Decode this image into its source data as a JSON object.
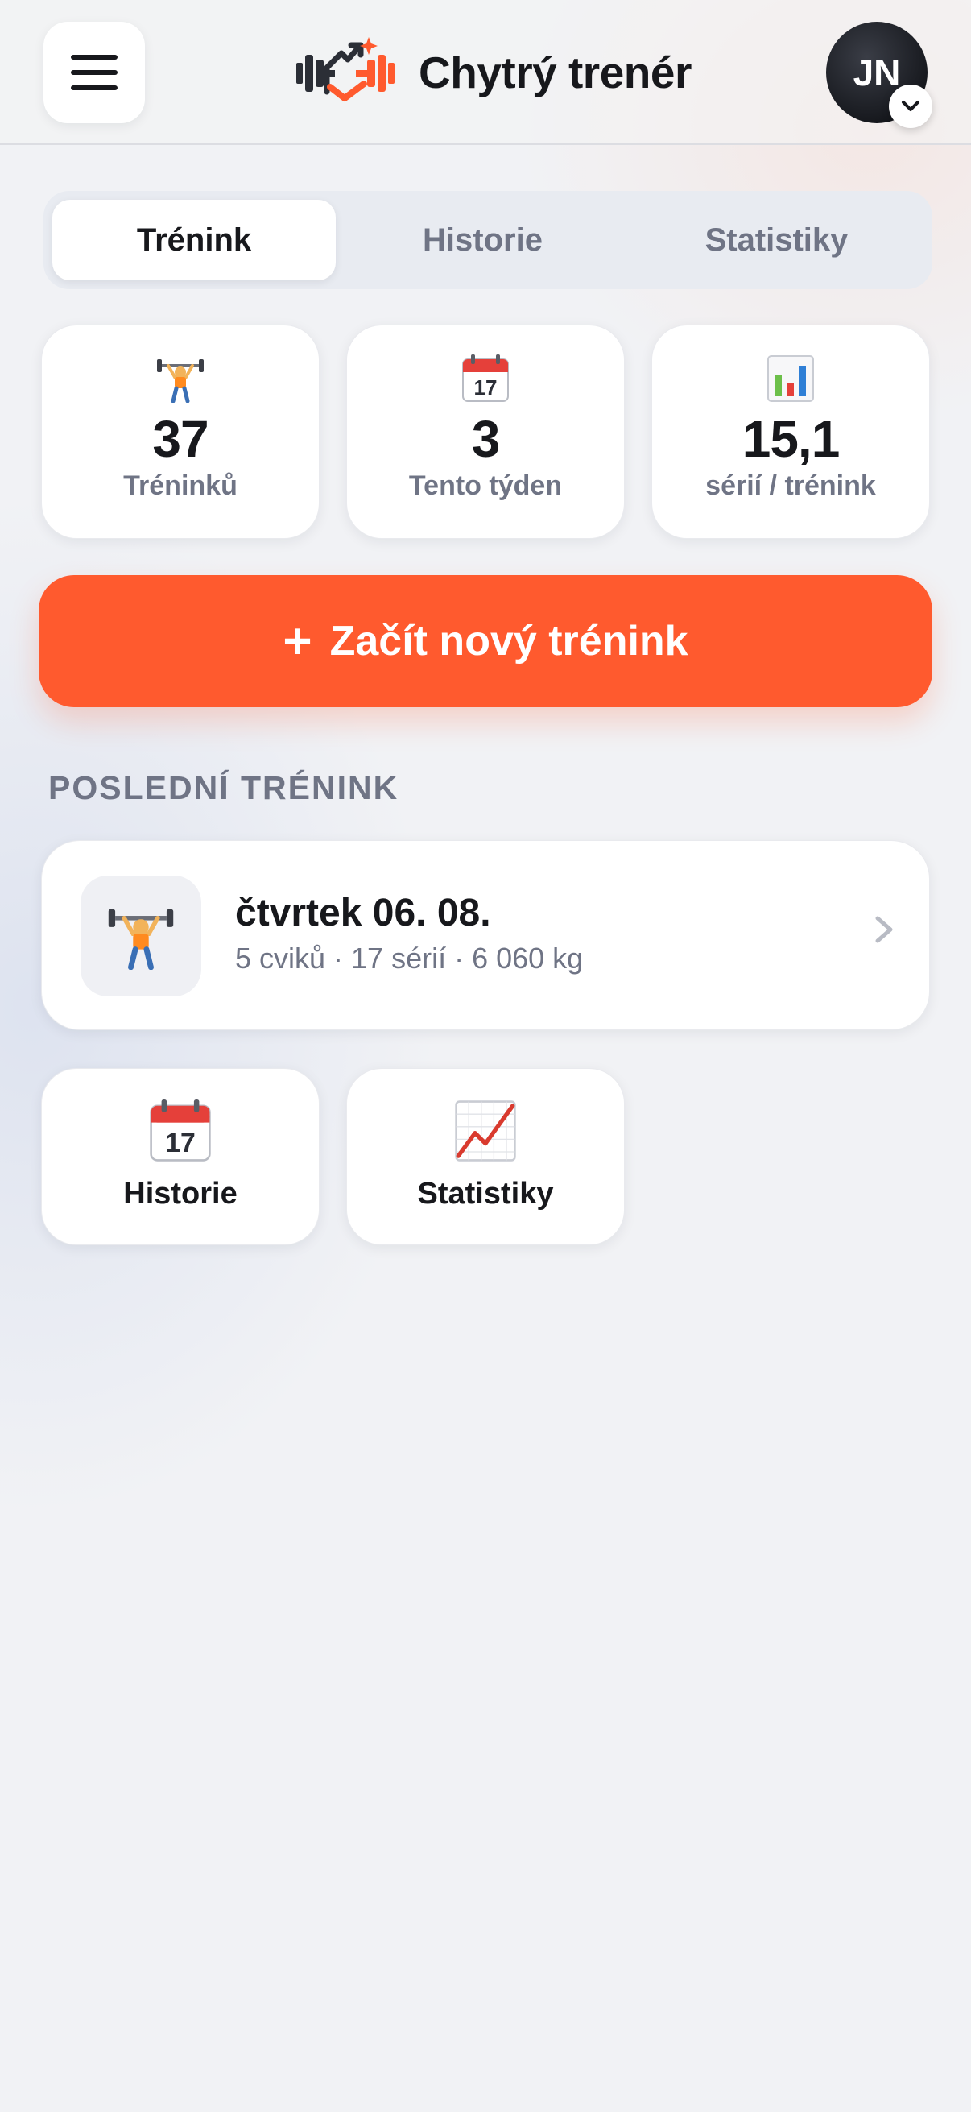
{
  "header": {
    "title": "Chytrý trenér",
    "avatar_initials": "JN"
  },
  "tabs": [
    {
      "label": "Trénink",
      "active": true
    },
    {
      "label": "Historie",
      "active": false
    },
    {
      "label": "Statistiky",
      "active": false
    }
  ],
  "stats": [
    {
      "icon": "weightlifter-icon",
      "value": "37",
      "label": "Tréninků"
    },
    {
      "icon": "calendar-icon",
      "value": "3",
      "label": "Tento týden"
    },
    {
      "icon": "bar-chart-icon",
      "value": "15,1",
      "label": "sérií / trénink"
    }
  ],
  "start_button": {
    "plus": "+",
    "label": "Začít nový trénink"
  },
  "last_workout": {
    "section_title": "POSLEDNÍ TRÉNINK",
    "date": "čtvrtek 06. 08.",
    "meta": "5 cviků · 17 sérií · 6 060 kg"
  },
  "tiles": [
    {
      "icon": "calendar-icon",
      "label": "Historie"
    },
    {
      "icon": "trend-chart-icon",
      "label": "Statistiky"
    }
  ],
  "colors": {
    "accent": "#ff5a2e",
    "text": "#17181c",
    "muted": "#6f7485",
    "background": "#f1f2f5"
  }
}
